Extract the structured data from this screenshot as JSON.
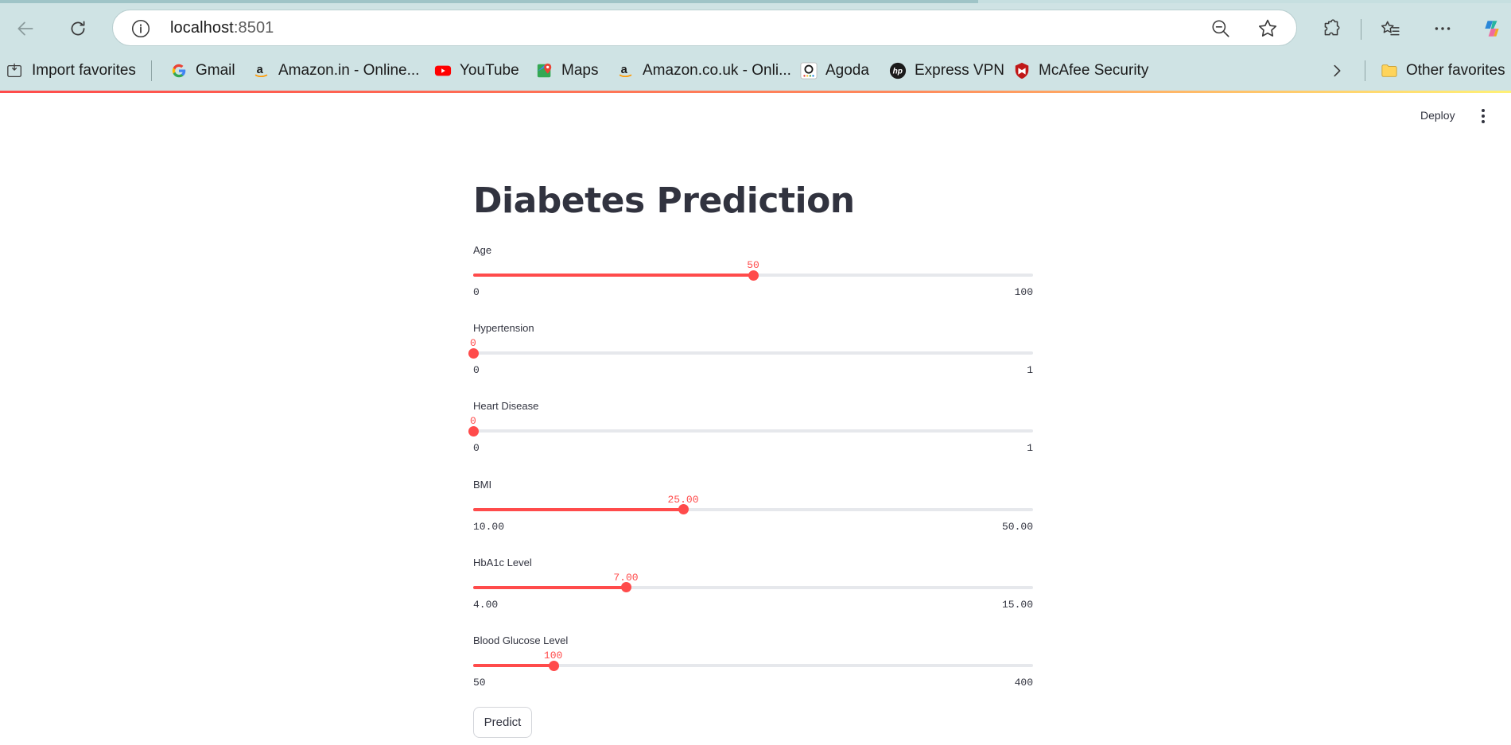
{
  "browser": {
    "url_host": "localhost",
    "url_port": ":8501",
    "bookmarks": [
      {
        "label": "Import favorites",
        "icon": "import-icon"
      },
      {
        "label": "Gmail",
        "icon": "google-icon"
      },
      {
        "label": "Amazon.in - Online...",
        "icon": "amazon-icon"
      },
      {
        "label": "YouTube",
        "icon": "youtube-icon"
      },
      {
        "label": "Maps",
        "icon": "maps-icon"
      },
      {
        "label": "Amazon.co.uk - Onli...",
        "icon": "amazon-icon"
      },
      {
        "label": "Agoda",
        "icon": "agoda-icon"
      },
      {
        "label": "Express VPN",
        "icon": "hp-icon"
      },
      {
        "label": "McAfee Security",
        "icon": "mcafee-icon"
      }
    ],
    "other_favorites": "Other favorites"
  },
  "app": {
    "deploy_label": "Deploy",
    "title": "Diabetes Prediction",
    "predict_label": "Predict",
    "accent": "#ff4b4b",
    "sliders": [
      {
        "label": "Age",
        "value": "50",
        "min": "0",
        "max": "100",
        "fraction": 0.5
      },
      {
        "label": "Hypertension",
        "value": "0",
        "min": "0",
        "max": "1",
        "fraction": 0
      },
      {
        "label": "Heart Disease",
        "value": "0",
        "min": "0",
        "max": "1",
        "fraction": 0
      },
      {
        "label": "BMI",
        "value": "25.00",
        "min": "10.00",
        "max": "50.00",
        "fraction": 0.375
      },
      {
        "label": "HbA1c Level",
        "value": "7.00",
        "min": "4.00",
        "max": "15.00",
        "fraction": 0.2727
      },
      {
        "label": "Blood Glucose Level",
        "value": "100",
        "min": "50",
        "max": "400",
        "fraction": 0.1429
      }
    ]
  }
}
